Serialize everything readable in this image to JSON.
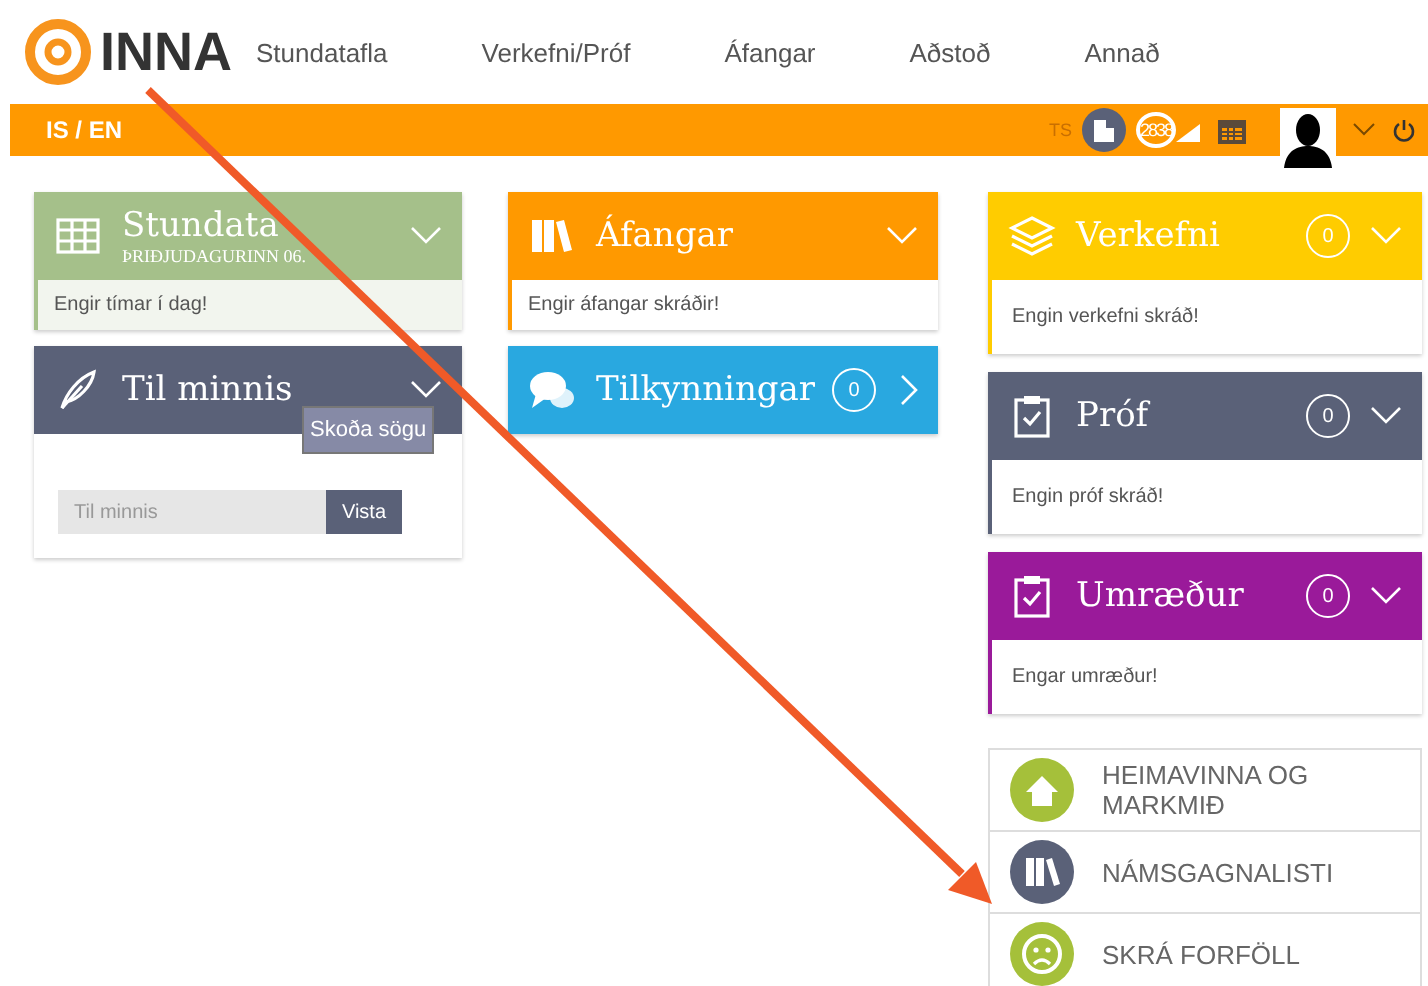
{
  "header": {
    "logo": "INNA",
    "nav": [
      {
        "label": "Stundatafla"
      },
      {
        "label": "Verkefni/Próf"
      },
      {
        "label": "Áfangar"
      },
      {
        "label": "Aðstoð"
      },
      {
        "label": "Annað"
      }
    ]
  },
  "topbar": {
    "language": "IS / EN",
    "initials": "TS",
    "badge": "2838"
  },
  "columns": [
    [
      {
        "kind": "schedule",
        "title": "Stundata",
        "subtitle": "ÞRIÐJUDAGURINN 06.",
        "color": "#a5c08a",
        "body": "Engir tímar í dag!"
      },
      {
        "kind": "memo",
        "title": "Til minnis",
        "color": "#5a6178",
        "tooltip": "Skoða sögu",
        "placeholder": "Til minnis",
        "button": "Vista"
      }
    ],
    [
      {
        "kind": "courses",
        "title": "Áfangar",
        "color": "#ff9900",
        "body": "Engir áfangar skráðir!"
      },
      {
        "kind": "notices",
        "title": "Tilkynningar",
        "color": "#29a8e0",
        "count": "0"
      }
    ],
    [
      {
        "kind": "tasks",
        "title": "Verkefni",
        "color": "#ffcc00",
        "count": "0",
        "body": "Engin verkefni skráð!"
      },
      {
        "kind": "exams",
        "title": "Próf",
        "color": "#5a6178",
        "count": "0",
        "body": "Engin próf skráð!"
      },
      {
        "kind": "forum",
        "title": "Umræður",
        "color": "#9a1a9a",
        "count": "0",
        "body": "Engar umræður!"
      }
    ]
  ],
  "links": [
    {
      "kind": "home",
      "label": "HEIMAVINNA OG MARKMIÐ",
      "color": "#a5c03a"
    },
    {
      "kind": "books",
      "label": "NÁMSGAGNALISTI",
      "color": "#5a6178"
    },
    {
      "kind": "sad",
      "label": "SKRÁ FORFÖLL",
      "color": "#a5c03a"
    }
  ]
}
